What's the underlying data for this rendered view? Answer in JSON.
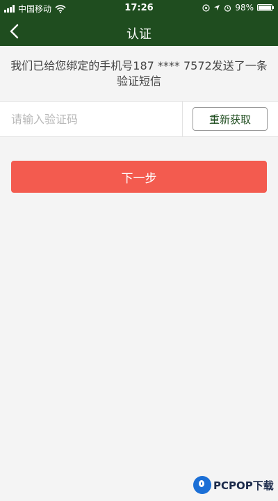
{
  "status_bar": {
    "carrier": "中国移动",
    "time": "17:26",
    "battery": "98%",
    "battery_level": 0.98,
    "icons": [
      "signal-icon",
      "wifi-icon",
      "location-icon",
      "alarm-icon",
      "battery-icon"
    ]
  },
  "nav": {
    "title": "认证",
    "back_icon": "chevron-left-icon"
  },
  "message": {
    "text": "我们已给您绑定的手机号187 **** 7572发送了一条验证短信"
  },
  "code_input": {
    "placeholder": "请输入验证码",
    "value": ""
  },
  "resend_button": {
    "label": "重新获取"
  },
  "next_button": {
    "label": "下一步"
  },
  "watermark": {
    "text": "PCPOP下载"
  },
  "colors": {
    "nav_background": "#1f4d1f",
    "page_background": "#f4f4f4",
    "primary_button": "#f35b4f",
    "resend_text": "#1f4d1f"
  }
}
